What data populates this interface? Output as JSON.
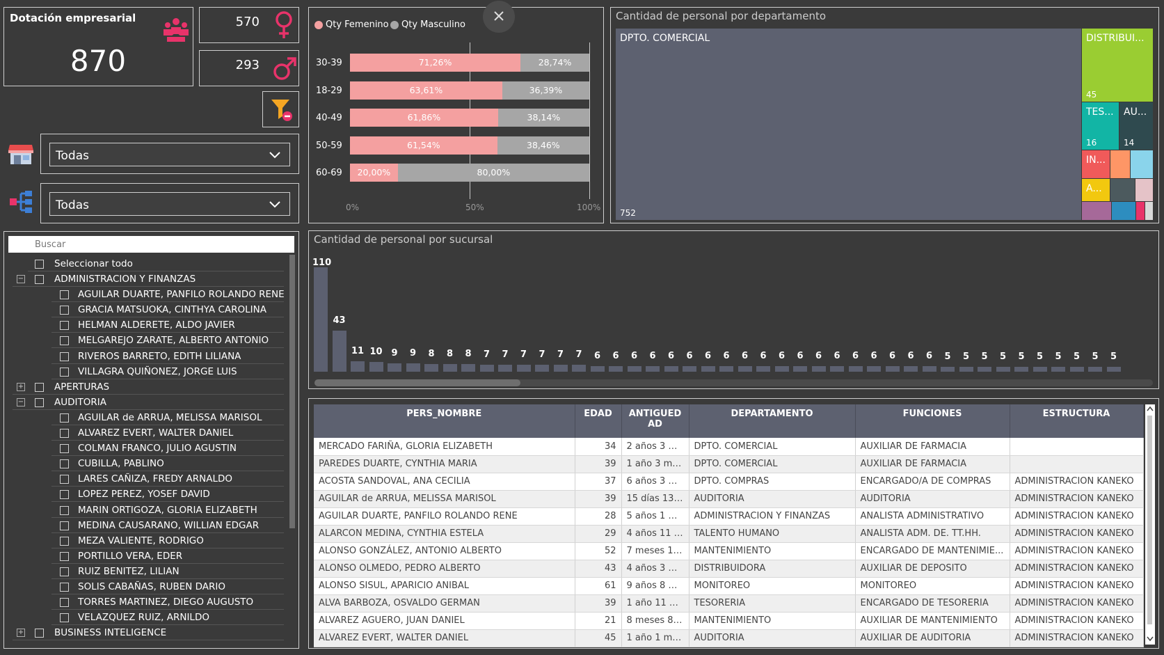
{
  "kpis": {
    "title": "Dotación empresarial",
    "total": "870",
    "female": "570",
    "male": "293"
  },
  "colors": {
    "female": "#f4a0a0",
    "male": "#a6a6a6",
    "accent": "#e8336a",
    "filter": "#f5a623"
  },
  "filters": {
    "dropdown1": "Todas",
    "dropdown2": "Todas"
  },
  "slicer": {
    "search_placeholder": "Buscar",
    "select_all": "Seleccionar todo",
    "items": [
      {
        "type": "group",
        "label": "ADMINISTRACION Y FINANZAS",
        "exp": "−"
      },
      {
        "type": "child",
        "label": "AGUILAR DUARTE, PANFILO ROLANDO RENE"
      },
      {
        "type": "child",
        "label": "GRACIA MATSUOKA, CINTHYA CAROLINA"
      },
      {
        "type": "child",
        "label": "HELMAN ALDERETE, ALDO JAVIER"
      },
      {
        "type": "child",
        "label": "MELGAREJO ZARATE, ALBERTO ANTONIO"
      },
      {
        "type": "child",
        "label": "RIVEROS BARRETO, EDITH LILIANA"
      },
      {
        "type": "child",
        "label": "VILLAGRA QUIÑONEZ, JORGE LUIS"
      },
      {
        "type": "group",
        "label": "APERTURAS",
        "exp": "+"
      },
      {
        "type": "group",
        "label": "AUDITORIA",
        "exp": "−"
      },
      {
        "type": "child",
        "label": "AGUILAR de ARRUA, MELISSA MARISOL"
      },
      {
        "type": "child",
        "label": "ALVAREZ EVERT, WALTER DANIEL"
      },
      {
        "type": "child",
        "label": "COLMAN FRANCO, JULIO AGUSTIN"
      },
      {
        "type": "child",
        "label": "CUBILLA, PABLINO"
      },
      {
        "type": "child",
        "label": "LARES CAÑIZA, FREDY ARNALDO"
      },
      {
        "type": "child",
        "label": "LOPEZ PEREZ, YOSEF DAVID"
      },
      {
        "type": "child",
        "label": "MARIN ORTIGOZA, GLORIA ELIZABETH"
      },
      {
        "type": "child",
        "label": "MEDINA CAUSARANO, WILLIAN EDGAR"
      },
      {
        "type": "child",
        "label": "MEZA VALIENTE, RODRIGO"
      },
      {
        "type": "child",
        "label": "PORTILLO VERA, EDER"
      },
      {
        "type": "child",
        "label": "RUIZ BENITEZ, LILIAN"
      },
      {
        "type": "child",
        "label": "SOLIS CABAÑAS, RUBEN DARIO"
      },
      {
        "type": "child",
        "label": "TORRES MARTINEZ, DIEGO AUGUSTO"
      },
      {
        "type": "child",
        "label": "VELAZQUEZ RUIZ, ARNILDO"
      },
      {
        "type": "group",
        "label": "BUSINESS INTELIGENCE",
        "exp": "+"
      }
    ]
  },
  "chart_data": [
    {
      "type": "bar",
      "orientation": "horizontal-stacked-100",
      "legend": [
        "Qty Femenino",
        "Qty Masculino"
      ],
      "categories": [
        "30-39",
        "18-29",
        "40-49",
        "50-59",
        "60-69"
      ],
      "series": [
        {
          "name": "Qty Femenino",
          "values": [
            71.26,
            63.61,
            61.86,
            61.54,
            20.0
          ],
          "labels": [
            "71,26%",
            "63,61%",
            "61,86%",
            "61,54%",
            "20,00%"
          ]
        },
        {
          "name": "Qty Masculino",
          "values": [
            28.74,
            36.39,
            38.14,
            38.46,
            80.0
          ],
          "labels": [
            "28,74%",
            "36,39%",
            "38,14%",
            "38,46%",
            "80,00%"
          ]
        }
      ],
      "xticks": [
        "0%",
        "50%",
        "100%"
      ]
    },
    {
      "type": "treemap",
      "title": "Cantidad de personal por departamento",
      "items": [
        {
          "name": "DPTO. COMERCIAL",
          "value": "752",
          "color": "#5d6170"
        },
        {
          "name": "DISTRIBUI...",
          "value": "45",
          "color": "#9acd32"
        },
        {
          "name": "TES...",
          "value": "16",
          "color": "#12b5a5"
        },
        {
          "name": "AU...",
          "value": "14",
          "color": "#2f4a4f"
        },
        {
          "name": "IN...",
          "value": "",
          "color": "#f05a5a"
        },
        {
          "name": "A...",
          "value": "",
          "color": "#f2c80f"
        }
      ]
    },
    {
      "type": "bar",
      "title": "Cantidad de personal por sucursal",
      "values": [
        110,
        43,
        11,
        10,
        9,
        9,
        8,
        8,
        8,
        7,
        7,
        7,
        7,
        7,
        7,
        6,
        6,
        6,
        6,
        6,
        6,
        6,
        6,
        6,
        6,
        6,
        6,
        6,
        6,
        6,
        6,
        6,
        6,
        6,
        5,
        5,
        5,
        5,
        5,
        5,
        5,
        5,
        5,
        5
      ]
    }
  ],
  "table": {
    "headers": [
      "PERS_NOMBRE",
      "EDAD",
      "ANTIGUEDAD",
      "DEPARTAMENTO",
      "FUNCIONES",
      "ESTRUCTURA"
    ],
    "rows": [
      [
        "MERCADO FARIÑA, GLORIA ELIZABETH",
        "34",
        "2 años 3 me...",
        "DPTO. COMERCIAL",
        "AUXILIAR DE FARMACIA",
        ""
      ],
      [
        "PAREDES DUARTE, CYNTHIA MARIA",
        "39",
        "1 año 3 mes...",
        "DPTO. COMERCIAL",
        "AUXILIAR DE FARMACIA",
        ""
      ],
      [
        "ACOSTA SANDOVAL, ANA CECILIA",
        "37",
        "6 años 3 me...",
        "DPTO. COMPRAS",
        "ENCARGADO/A DE COMPRAS",
        "ADMINISTRACION KANEKO"
      ],
      [
        "AGUILAR de ARRUA, MELISSA MARISOL",
        "39",
        "15 días 13 hr...",
        "AUDITORIA",
        "AUDITORIA",
        "ADMINISTRACION KANEKO"
      ],
      [
        "AGUILAR DUARTE, PANFILO ROLANDO RENE",
        "28",
        "5 años 1 me...",
        "ADMINISTRACION Y FINANZAS",
        "ANALISTA ADMINISTRATIVO",
        "ADMINISTRACION KANEKO"
      ],
      [
        "ALARCON MEDINA, CYNTHIA ESTELA",
        "29",
        "4 años 11 m...",
        "TALENTO HUMANO",
        "ANALISTA ADM. DE. TT.HH.",
        "ADMINISTRACION KANEKO"
      ],
      [
        "ALONSO GONZÁLEZ, ANTONIO ALBERTO",
        "52",
        "7 meses 15 ...",
        "MANTENIMIENTO",
        "ENCARGADO DE MANTENIMIE...",
        "ADMINISTRACION KANEKO"
      ],
      [
        "ALONSO OLMEDO, PEDRO ALBERTO",
        "43",
        "4 años 3 me...",
        "DISTRIBUIDORA",
        "AUXILIAR DE DEPOSITO",
        "ADMINISTRACION KANEKO"
      ],
      [
        "ALONSO SISUL, APARICIO ANIBAL",
        "61",
        "9 años 8 me...",
        "MONITOREO",
        "MONITOREO",
        "ADMINISTRACION KANEKO"
      ],
      [
        "ALVA BARBOZA, OSVALDO GERMAN",
        "39",
        "1 año 11 me...",
        "TESORERIA",
        "ENCARGADO DE TESORERIA",
        "ADMINISTRACION KANEKO"
      ],
      [
        "ALVAREZ AGUERO, JUAN DANIEL",
        "21",
        "8 meses 8 dí...",
        "MANTENIMIENTO",
        "AUXILIAR DE MANTENIMIENTO",
        "ADMINISTRACION KANEKO"
      ],
      [
        "ALVAREZ EVERT, WALTER DANIEL",
        "45",
        "1 año 1 mes ...",
        "AUDITORIA",
        "AUXILIAR DE AUDITORIA",
        "ADMINISTRACION KANEKO"
      ]
    ]
  }
}
